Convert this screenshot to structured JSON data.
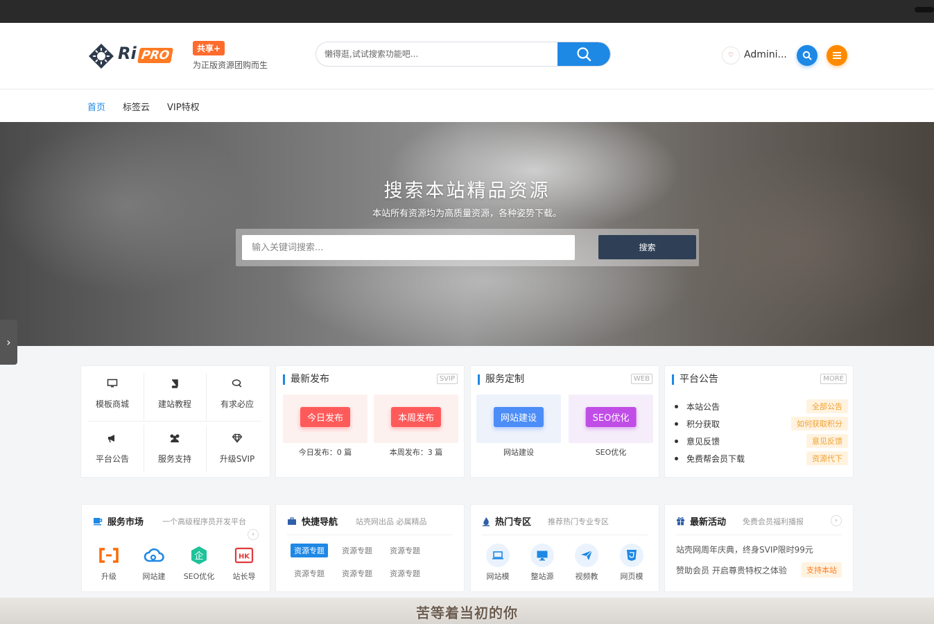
{
  "header": {
    "logo": {
      "text": "Ri",
      "pro": "PRO"
    },
    "share_badge": "共享+",
    "slogan": "为正版资源团购而生",
    "search_placeholder": "懒得逛,试试搜索功能吧...",
    "user_name": "Admini...",
    "avatar_text": "♡"
  },
  "nav": {
    "items": [
      "首页",
      "标签云",
      "VIP特权"
    ]
  },
  "hero": {
    "title": "搜索本站精品资源",
    "subtitle": "本站所有资源均为高质量资源，各种姿势下载。",
    "search_placeholder": "输入关键词搜索...",
    "search_button": "搜索"
  },
  "quick_grid": {
    "items": [
      {
        "label": "模板商城",
        "icon": "monitor-icon"
      },
      {
        "label": "建站教程",
        "icon": "book-icon"
      },
      {
        "label": "有求必应",
        "icon": "chat-icon"
      },
      {
        "label": "平台公告",
        "icon": "megaphone-icon"
      },
      {
        "label": "服务支持",
        "icon": "users-icon"
      },
      {
        "label": "升级SVIP",
        "icon": "diamond-icon"
      }
    ]
  },
  "latest": {
    "title": "最新发布",
    "tag": "SVIP",
    "tiles": [
      {
        "button": "今日发布",
        "caption": "今日发布：0 篇"
      },
      {
        "button": "本周发布",
        "caption": "本周发布：3 篇"
      }
    ]
  },
  "service": {
    "title": "服务定制",
    "tag": "WEB",
    "tiles": [
      {
        "button": "网站建设",
        "caption": "网站建设"
      },
      {
        "button": "SEO优化",
        "caption": "SEO优化"
      }
    ]
  },
  "notice": {
    "title": "平台公告",
    "tag": "MORE",
    "items": [
      {
        "text": "本站公告",
        "badge": "全部公告"
      },
      {
        "text": "积分获取",
        "badge": "如何获取积分"
      },
      {
        "text": "意见反馈",
        "badge": "意见反馈"
      },
      {
        "text": "免费帮会员下载",
        "badge": "资源代下"
      }
    ]
  },
  "market": {
    "title": "服务市场",
    "sub": "一个高级程序员开发平台",
    "items": [
      {
        "label": "升级",
        "icon": "bracket-icon"
      },
      {
        "label": "网站建",
        "icon": "cloud-icon"
      },
      {
        "label": "SEO优化",
        "icon": "enterprise-icon",
        "glyph": "企"
      },
      {
        "label": "站长导",
        "icon": "hk-icon",
        "glyph": "HK"
      }
    ]
  },
  "quicknav": {
    "title": "快捷导航",
    "sub": "站壳网出品 必属精品",
    "chips": [
      "资源专题",
      "资源专题",
      "资源专题",
      "资源专题",
      "资源专题",
      "资源专题"
    ]
  },
  "hot": {
    "title": "热门专区",
    "sub": "推荐热门专业专区",
    "items": [
      {
        "label": "网站模",
        "icon": "laptop-icon"
      },
      {
        "label": "整站源",
        "icon": "desktop-icon"
      },
      {
        "label": "视频教",
        "icon": "send-icon"
      },
      {
        "label": "网页模",
        "icon": "html5-icon"
      }
    ]
  },
  "activity": {
    "title": "最新活动",
    "sub": "免费会员福利播报",
    "line1": "站壳网周年庆典，终身SVIP限时99元",
    "line2": "赞助会员 开启尊贵特权之体验",
    "button": "支持本站"
  },
  "subtitle_caption": "苦等着当初的你",
  "colors": {
    "accent": "#1e88e5",
    "orange": "#ff7a22",
    "dark_button": "#2f4056"
  }
}
